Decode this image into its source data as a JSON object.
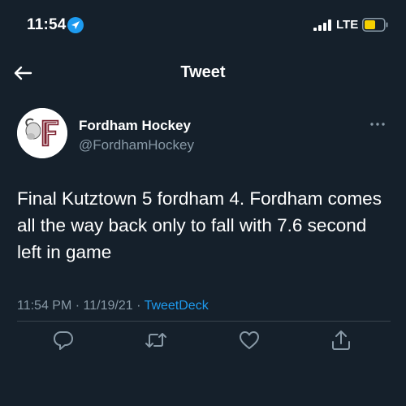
{
  "status_bar": {
    "time": "11:54",
    "network": "LTE",
    "icons": [
      "location-arrow-icon",
      "signal-icon",
      "battery-icon"
    ],
    "battery_color": "#f5d000"
  },
  "header": {
    "title": "Tweet",
    "back_icon": "arrow-left-icon"
  },
  "tweet": {
    "author_name": "Fordham Hockey",
    "author_handle": "@FordhamHockey",
    "text": "Final Kutztown 5 fordham 4. Fordham comes all the way back only to fall with 7.6 second left in game",
    "time": "11:54 PM",
    "date": "11/19/21",
    "separator": "·",
    "source": "TweetDeck",
    "actions": [
      "reply-icon",
      "retweet-icon",
      "like-icon",
      "share-icon"
    ]
  },
  "colors": {
    "background": "#15202b",
    "text": "#ffffff",
    "secondary_text": "#8899a6",
    "accent": "#1d9bf0",
    "divider": "#38444d",
    "logo_maroon": "#7b1f2e"
  }
}
